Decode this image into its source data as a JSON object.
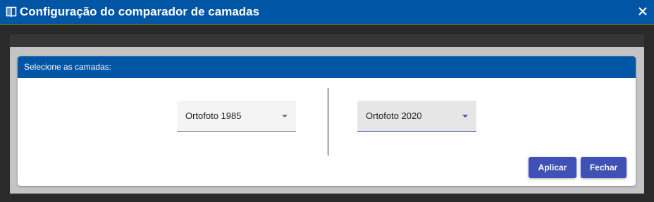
{
  "dialog": {
    "title": "Configuração do comparador de camadas",
    "title_icon": "compare-layers-icon",
    "close_icon": "close-icon"
  },
  "panel": {
    "header": "Selecione as camadas:"
  },
  "selects": {
    "left": {
      "value": "Ortofoto 1985"
    },
    "right": {
      "value": "Ortofoto 2020"
    }
  },
  "actions": {
    "apply_label": "Aplicar",
    "close_label": "Fechar"
  },
  "colors": {
    "header_blue": "#0055a5",
    "button_indigo": "#3f51b5"
  }
}
